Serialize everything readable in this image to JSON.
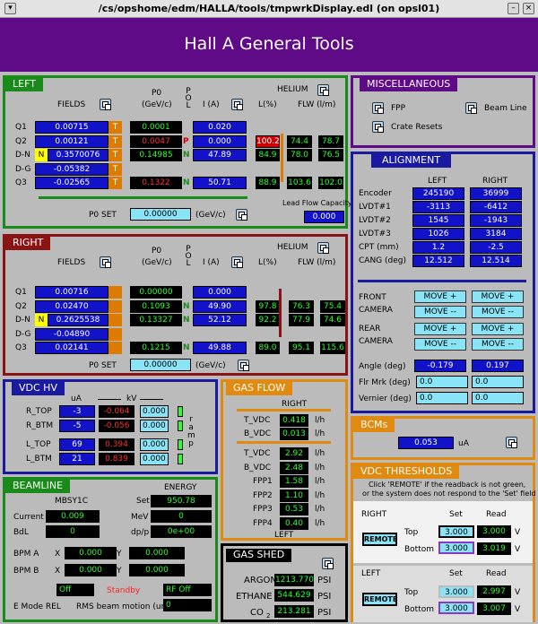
{
  "window": {
    "title": "/cs/opshome/edm/HALLA/tools/tmpwrkDisplay.edl (on opsl01)",
    "minimize": "–",
    "close": "×"
  },
  "header": {
    "title": "Hall A General Tools"
  },
  "left": {
    "title": "LEFT",
    "fields": "FIELDS",
    "p0": "P0",
    "p0unit": "(GeV/c)",
    "pol": "P O L",
    "ia": "I (A)",
    "lpct": "L(%)",
    "helium": "HELIUM",
    "flw": "FLW (l/m)",
    "rows": [
      {
        "name": "Q1",
        "field": "0.00715",
        "t": "T",
        "p0": "0.0001",
        "pol": "",
        "i": "0.020",
        "l": "",
        "f1": "",
        "f2": ""
      },
      {
        "name": "Q2",
        "field": "0.00121",
        "t": "T",
        "p0": "0.0047",
        "pol": "P",
        "i": "0.000",
        "l": "100.2",
        "f1": "74.4",
        "f2": "78.7"
      },
      {
        "name": "D-N",
        "field": "0.3570076",
        "t": "T",
        "p0": "0.14985",
        "pol": "N",
        "i": "47.89",
        "l": "84.9",
        "f1": "78.0",
        "f2": "76.5",
        "n": "N"
      },
      {
        "name": "D-G",
        "field": "-0.05382",
        "t": "T",
        "p0": "",
        "pol": "",
        "i": "",
        "l": "",
        "f1": "",
        "f2": ""
      },
      {
        "name": "Q3",
        "field": "-0.02565",
        "t": "T",
        "p0": "0.1322",
        "pol": "N",
        "i": "50.71",
        "l": "88.9",
        "f1": "103.6",
        "f2": "102.0"
      }
    ],
    "p0set": "P0 SET",
    "p0setval": "0.00000",
    "gevc": "(GeV/c)",
    "leadflow": "Lead Flow Capacity",
    "leadflowval": "0.000"
  },
  "right": {
    "title": "RIGHT",
    "fields": "FIELDS",
    "p0": "P0",
    "p0unit": "(GeV/c)",
    "pol": "P O L",
    "ia": "I (A)",
    "lpct": "L(%)",
    "helium": "HELIUM",
    "flw": "FLW (l/m)",
    "rows": [
      {
        "name": "Q1",
        "field": "0.00716",
        "p0": "0.00000",
        "pol": "",
        "i": "0.000",
        "l": "",
        "f1": "",
        "f2": ""
      },
      {
        "name": "Q2",
        "field": "0.02470",
        "p0": "0.1093",
        "pol": "N",
        "i": "49.90",
        "l": "97.8",
        "f1": "76.3",
        "f2": "75.4"
      },
      {
        "name": "D-N",
        "field": "0.2625538",
        "p0": "0.13327",
        "pol": "N",
        "i": "52.12",
        "l": "92.2",
        "f1": "77.9",
        "f2": "74.6",
        "n": "N"
      },
      {
        "name": "D-G",
        "field": "-0.04890",
        "p0": "",
        "pol": "",
        "i": "",
        "l": "",
        "f1": "",
        "f2": ""
      },
      {
        "name": "Q3",
        "field": "0.02141",
        "p0": "0.1215",
        "pol": "N",
        "i": "49.88",
        "l": "89.0",
        "f1": "95.1",
        "f2": "115.6"
      }
    ],
    "p0set": "P0 SET",
    "p0setval": "0.00000",
    "gevc": "(GeV/c)"
  },
  "misc": {
    "title": "MISCELLANEOUS",
    "fpp": "FPP",
    "beamline": "Beam Line",
    "crate": "Crate Resets"
  },
  "align": {
    "title": "ALIGNMENT",
    "left": "LEFT",
    "right": "RIGHT",
    "rows": [
      {
        "name": "Encoder",
        "l": "245190",
        "r": "36999"
      },
      {
        "name": "LVDT#1",
        "l": "-3113",
        "r": "-6412"
      },
      {
        "name": "LVDT#2",
        "l": "1545",
        "r": "-1943"
      },
      {
        "name": "LVDT#3",
        "l": "1026",
        "r": "3184"
      },
      {
        "name": "CPT (mm)",
        "l": "1.2",
        "r": "-2.5"
      },
      {
        "name": "CANG (deg)",
        "l": "12.512",
        "r": "12.514"
      }
    ],
    "front": "FRONT",
    "rear": "REAR",
    "camera": "CAMERA",
    "moveplus": "MOVE +",
    "moveminus": "MOVE --",
    "angle": "Angle (deg)",
    "anglel": "-0.179",
    "angler": "0.197",
    "flr": "Flr Mrk (deg)",
    "flrl": "0.0",
    "flrr": "0.0",
    "vernier": "Vernier (deg)",
    "vernl": "0.0",
    "vernr": "0.0"
  },
  "vdchv": {
    "title": "VDC HV",
    "ua": "uA",
    "kv": "kV",
    "ramp": "r a m p",
    "rows": [
      {
        "name": "R_TOP",
        "ua": "-3",
        "kv": "-0.064",
        "set": "0.000"
      },
      {
        "name": "R_BTM",
        "ua": "-5",
        "kv": "-0.056",
        "set": "0.000"
      },
      {
        "name": "L_TOP",
        "ua": "69",
        "kv": "0.394",
        "set": "0.000"
      },
      {
        "name": "L_BTM",
        "ua": "21",
        "kv": "0.839",
        "set": "0.000"
      }
    ]
  },
  "gasflow": {
    "title": "GAS FLOW",
    "right": "RIGHT",
    "left": "LEFT",
    "unit": "l/h",
    "rows1": [
      {
        "name": "T_VDC",
        "v": "0.418"
      },
      {
        "name": "B_VDC",
        "v": "0.013"
      }
    ],
    "rows2": [
      {
        "name": "T_VDC",
        "v": "2.92"
      },
      {
        "name": "B_VDC",
        "v": "2.48"
      },
      {
        "name": "FPP1",
        "v": "1.58"
      },
      {
        "name": "FPP2",
        "v": "1.10"
      },
      {
        "name": "FPP3",
        "v": "0.53"
      },
      {
        "name": "FPP4",
        "v": "0.40"
      }
    ]
  },
  "bcms": {
    "title": "BCMs",
    "value": "0.053",
    "unit": "uA"
  },
  "vdcth": {
    "title": "VDC THRESHOLDS",
    "note1": "Click 'REMOTE' if the readback is not green,",
    "note2": "or the system does not respond to the 'Set' field",
    "right": "RIGHT",
    "left": "LEFT",
    "set": "Set",
    "read": "Read",
    "remote": "REMOTE",
    "top": "Top",
    "bottom": "Bottom",
    "v": "V",
    "rtop": "3.000",
    "rtopread": "3.000",
    "rbtm": "3.000",
    "rbtmread": "3.019",
    "ltop": "3.000",
    "ltopread": "2.997",
    "lbtm": "3.000",
    "lbtmread": "3.007"
  },
  "beamline": {
    "title": "BEAMLINE",
    "device": "MBSY1C",
    "energy": "ENERGY",
    "set": "Set",
    "setval": "950.78",
    "current": "Current",
    "currentval": "0.009",
    "mev": "MeV",
    "mevval": "0",
    "bdl": "BdL",
    "bdlval": "0",
    "dpp": "dp/p",
    "dppval": "0e+00",
    "bpma": "BPM A",
    "bpmb": "BPM B",
    "x": "X",
    "y": "Y",
    "bpmax": "0.000",
    "bpmay": "0.000",
    "bpmbx": "0.000",
    "bpmby": "0.000",
    "off": "Off",
    "standby": "Standby",
    "rfoff": "RF Off",
    "emode": "E Mode REL",
    "rms": "RMS beam motion (um",
    "rmsval": "0"
  },
  "gasshed": {
    "title": "GAS SHED",
    "argon": "ARGON",
    "argonval": "1213.770",
    "ethane": "ETHANE",
    "ethaneval": "544.629",
    "co2": "CO",
    "co2sub": "2",
    "co2val": "213.281",
    "psi": "PSI"
  }
}
